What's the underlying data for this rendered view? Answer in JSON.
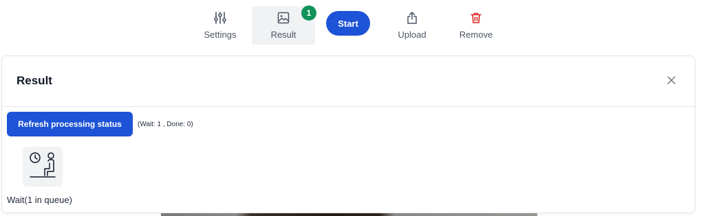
{
  "toolbar": {
    "settings_label": "Settings",
    "result_label": "Result",
    "result_badge": "1",
    "start_label": "Start",
    "upload_label": "Upload",
    "remove_label": "Remove",
    "icons": {
      "settings": "sliders-icon",
      "result": "image-icon",
      "upload": "upload-icon",
      "remove": "trash-icon"
    },
    "colors": {
      "accent": "#1d53d6",
      "badge": "#10925a",
      "remove_icon": "#dc2626"
    }
  },
  "panel": {
    "title": "Result",
    "close_icon": "close-icon",
    "refresh_label": "Refresh processing status",
    "status_text": "(Wait: 1 , Done: 0)",
    "wait_icon": "waiting-person-clock-icon",
    "wait_label": "Wait(1 in queue)"
  }
}
